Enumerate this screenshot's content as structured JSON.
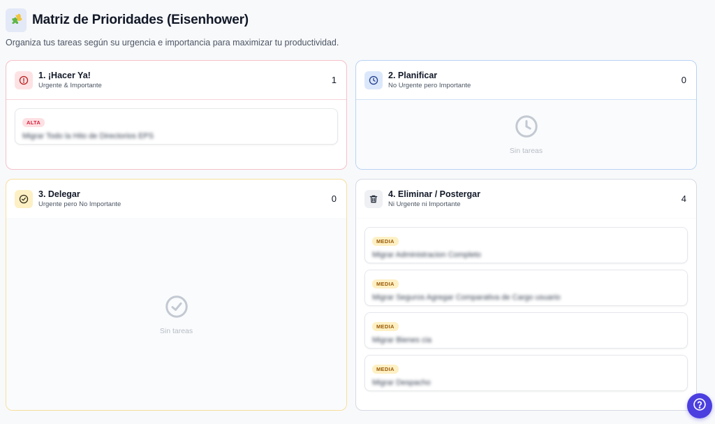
{
  "header": {
    "title": "Matriz de Prioridades (Eisenhower)",
    "subtitle": "Organiza tus tareas según su urgencia e importancia para maximizar tu productividad.",
    "logo_icon": "puzzle-icon"
  },
  "quadrants": [
    {
      "title": "1. ¡Hacer Ya!",
      "subtitle": "Urgente & Importante",
      "count": "1",
      "icon": "alert-circle-icon",
      "accent": "#e23b52",
      "tasks": [
        {
          "priority": "ALTA",
          "text": "Migrar Todo la Hito de Directorios EPS"
        }
      ]
    },
    {
      "title": "2. Planificar",
      "subtitle": "No Urgente pero Importante",
      "count": "0",
      "icon": "clock-icon",
      "accent": "#3b6fd8",
      "empty_text": "Sin tareas"
    },
    {
      "title": "3. Delegar",
      "subtitle": "Urgente pero No Importante",
      "count": "0",
      "icon": "check-circle-icon",
      "accent": "#c98b06",
      "empty_text": "Sin tareas"
    },
    {
      "title": "4. Eliminar / Postergar",
      "subtitle": "Ni Urgente ni Importante",
      "count": "4",
      "icon": "trash-icon",
      "accent": "#4b5563",
      "tasks": [
        {
          "priority": "MEDIA",
          "text": "Migrar Administracion Completo"
        },
        {
          "priority": "MEDIA",
          "text": "Migrar Seguros Agregar Comparativa de Cargo usuario"
        },
        {
          "priority": "MEDIA",
          "text": "Migrar Bienes cia"
        },
        {
          "priority": "MEDIA",
          "text": "Migrar Despacho"
        }
      ]
    }
  ],
  "help": {
    "icon": "help-circle-icon"
  }
}
